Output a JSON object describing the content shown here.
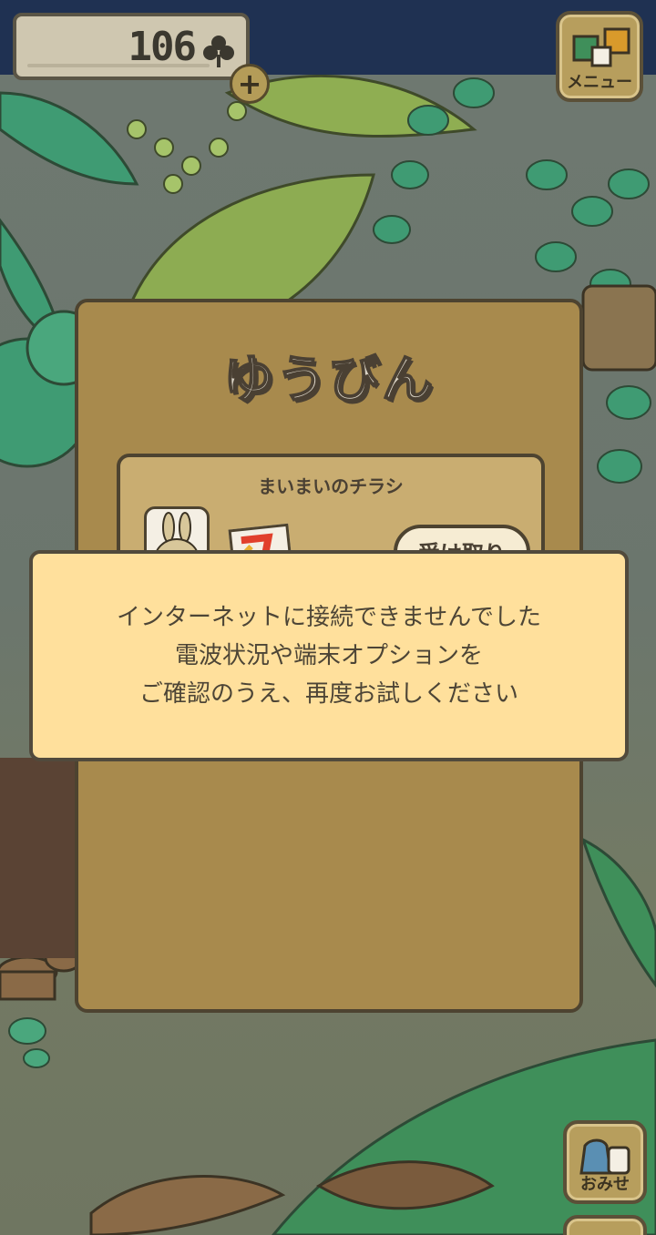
{
  "header": {
    "coin_count": "106",
    "plus_label": "+",
    "menu_label": "メニュー"
  },
  "mail": {
    "title": "ゆうびん",
    "item": {
      "title": "まいまいのチラシ",
      "receive_label": "受け取り"
    }
  },
  "error_dialog": {
    "line1": "インターネットに接続できませんでした",
    "line2": "電波状況や端末オプションを",
    "line3": "ご確認のうえ、再度お試しください"
  },
  "footer": {
    "shop_label": "おみせ"
  },
  "colors": {
    "topbar": "#1f3152",
    "panel": "#a88a4d",
    "dialog": "#ffe09c",
    "outline": "#4d4330"
  }
}
